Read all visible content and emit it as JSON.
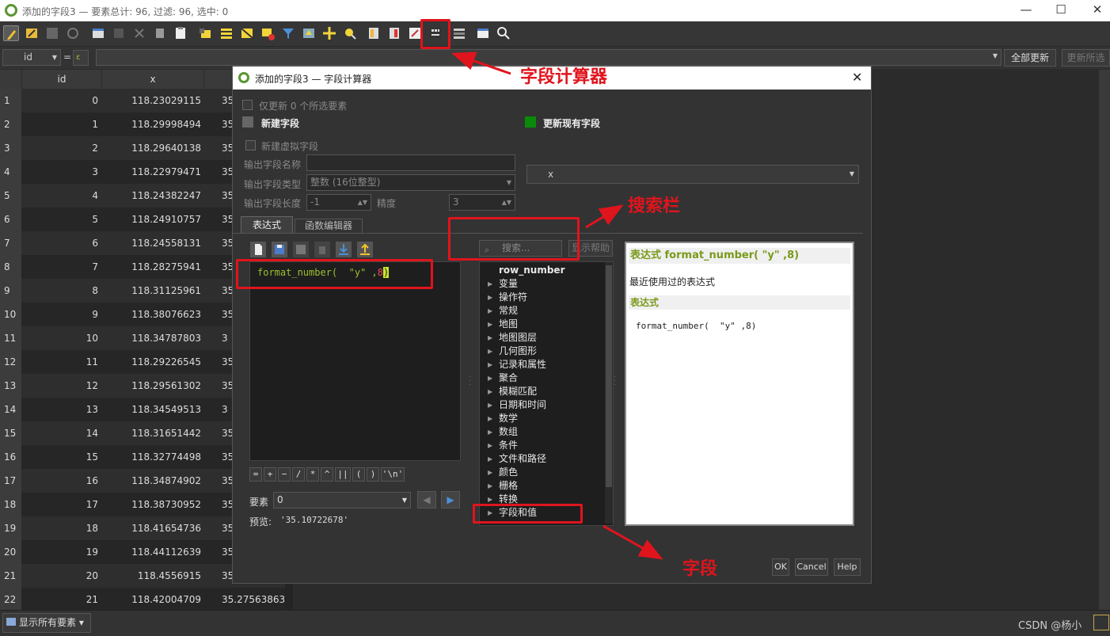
{
  "window": {
    "title": "添加的字段3 — 要素总计: 96, 过滤: 96, 选中: 0",
    "minimize": "—",
    "maximize": "☐",
    "close": "✕"
  },
  "filterbar": {
    "field": "id",
    "eq": "=",
    "update_all": "全部更新",
    "update_selected": "更新所选"
  },
  "table": {
    "headers": [
      "id",
      "x"
    ],
    "rows": [
      [
        "1",
        "0",
        "118.23029115",
        "35"
      ],
      [
        "2",
        "1",
        "118.29998494",
        "35"
      ],
      [
        "3",
        "2",
        "118.29640138",
        "35"
      ],
      [
        "4",
        "3",
        "118.22979471",
        "35"
      ],
      [
        "5",
        "4",
        "118.24382247",
        "35"
      ],
      [
        "6",
        "5",
        "118.24910757",
        "35"
      ],
      [
        "7",
        "6",
        "118.24558131",
        "35"
      ],
      [
        "8",
        "7",
        "118.28275941",
        "35"
      ],
      [
        "9",
        "8",
        "118.31125961",
        "35"
      ],
      [
        "10",
        "9",
        "118.38076623",
        "35"
      ],
      [
        "11",
        "10",
        "118.34787803",
        "3"
      ],
      [
        "12",
        "11",
        "118.29226545",
        "35"
      ],
      [
        "13",
        "12",
        "118.29561302",
        "35"
      ],
      [
        "14",
        "13",
        "118.34549513",
        "3"
      ],
      [
        "15",
        "14",
        "118.31651442",
        "35"
      ],
      [
        "16",
        "15",
        "118.32774498",
        "35"
      ],
      [
        "17",
        "16",
        "118.34874902",
        "35"
      ],
      [
        "18",
        "17",
        "118.38730952",
        "35"
      ],
      [
        "19",
        "18",
        "118.41654736",
        "35"
      ],
      [
        "20",
        "19",
        "118.44112639",
        "35"
      ],
      [
        "21",
        "20",
        "118.4556915",
        "35"
      ],
      [
        "22",
        "21",
        "118.42004709",
        "35.27563863"
      ]
    ]
  },
  "statusbar": {
    "show_all": "显示所有要素",
    "watermark": "CSDN @杨小"
  },
  "dialog": {
    "title": "添加的字段3 — 字段计算器",
    "only_update": "仅更新 0 个所选要素",
    "new_field": "新建字段",
    "update_existing": "更新现有字段",
    "virtual_field": "新建虚拟字段",
    "out_name_label": "输出字段名称",
    "out_type_label": "输出字段类型",
    "out_type_value": "整数 (16位整型)",
    "out_len_label": "输出字段长度",
    "out_len_value": "-1",
    "precision_label": "精度",
    "precision_value": "3",
    "existing_field_value": "x",
    "tab_expression": "表达式",
    "tab_function_editor": "函数编辑器",
    "expr_parts": [
      "format_number(",
      "  \"y\" ,",
      "8",
      ")"
    ],
    "operators": [
      "=",
      "+",
      "−",
      "/",
      "*",
      "^",
      "||",
      "(",
      ")",
      "'\\n'"
    ],
    "feature_label": "要素",
    "feature_value": "0",
    "preview_label": "预览:",
    "preview_value": "'35.10722678'",
    "search_placeholder": "搜索...",
    "show_help": "显示帮助",
    "tree": [
      {
        "label": "row_number",
        "bold": true,
        "arrow": false
      },
      {
        "label": "变量",
        "arrow": true
      },
      {
        "label": "操作符",
        "arrow": true
      },
      {
        "label": "常规",
        "arrow": true
      },
      {
        "label": "地图",
        "arrow": true
      },
      {
        "label": "地图图层",
        "arrow": true
      },
      {
        "label": "几何图形",
        "arrow": true
      },
      {
        "label": "记录和属性",
        "arrow": true
      },
      {
        "label": "聚合",
        "arrow": true
      },
      {
        "label": "模糊匹配",
        "arrow": true
      },
      {
        "label": "日期和时间",
        "arrow": true
      },
      {
        "label": "数学",
        "arrow": true
      },
      {
        "label": "数组",
        "arrow": true
      },
      {
        "label": "条件",
        "arrow": true
      },
      {
        "label": "文件和路径",
        "arrow": true
      },
      {
        "label": "颜色",
        "arrow": true
      },
      {
        "label": "栅格",
        "arrow": true
      },
      {
        "label": "转换",
        "arrow": true
      },
      {
        "label": "字段和值",
        "arrow": true
      }
    ],
    "help_title": "表达式 format_number( \"y\" ,8)",
    "help_recent": "最近使用过的表达式",
    "help_section": "表达式",
    "help_code": "format_number(  \"y\" ,8)",
    "ok": "OK",
    "cancel": "Cancel",
    "help": "Help"
  },
  "annotations": {
    "calc": "字段计算器",
    "search": "搜索栏",
    "field": "字段"
  },
  "colors": {
    "accent_red": "#e0141d",
    "qgis_green": "#589632",
    "keyword_green": "#9ac02f"
  }
}
